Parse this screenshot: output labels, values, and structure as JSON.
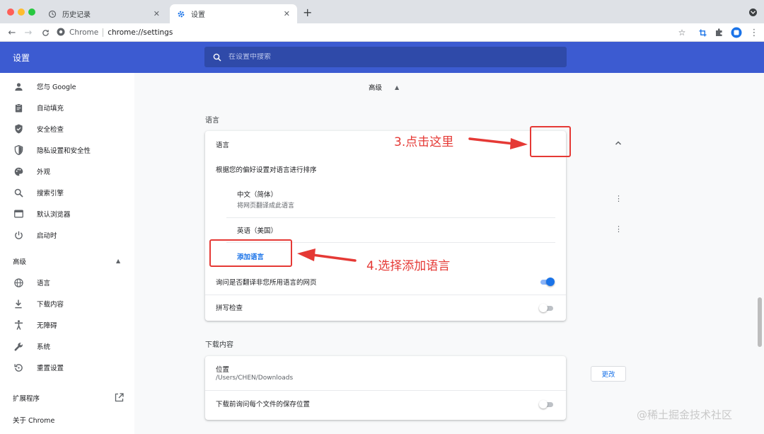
{
  "tabs": [
    {
      "title": "历史记录",
      "icon": "history-icon",
      "active": false
    },
    {
      "title": "设置",
      "icon": "gear-icon",
      "active": true
    }
  ],
  "toolbar": {
    "omnibox_chrome_label": "Chrome",
    "omnibox_url": "chrome://settings"
  },
  "header": {
    "title": "设置",
    "search_placeholder": "在设置中搜索"
  },
  "sidebar": {
    "items": [
      {
        "label": "您与 Google",
        "icon": "person-icon"
      },
      {
        "label": "自动填充",
        "icon": "clipboard-icon"
      },
      {
        "label": "安全检查",
        "icon": "shield-check-icon"
      },
      {
        "label": "隐私设置和安全性",
        "icon": "privacy-shield-icon"
      },
      {
        "label": "外观",
        "icon": "palette-icon"
      },
      {
        "label": "搜索引擎",
        "icon": "search-icon"
      },
      {
        "label": "默认浏览器",
        "icon": "browser-icon"
      },
      {
        "label": "启动时",
        "icon": "power-icon"
      }
    ],
    "advanced_label": "高级",
    "advanced_items": [
      {
        "label": "语言",
        "icon": "globe-icon"
      },
      {
        "label": "下载内容",
        "icon": "download-icon"
      },
      {
        "label": "无障碍",
        "icon": "accessibility-icon"
      },
      {
        "label": "系统",
        "icon": "wrench-icon"
      },
      {
        "label": "重置设置",
        "icon": "reset-icon"
      }
    ],
    "extensions_label": "扩展程序",
    "about_label": "关于 Chrome"
  },
  "main": {
    "advanced_toggle_label": "高级",
    "language_section": {
      "title": "语言",
      "header_label": "语言",
      "order_desc": "根据您的偏好设置对语言进行排序",
      "languages": [
        {
          "name": "中文（简体）",
          "subtitle": "将网页翻译成此语言"
        },
        {
          "name": "英语（美国）",
          "subtitle": ""
        }
      ],
      "add_language": "添加语言",
      "translate_offer": "询问是否翻译非您所用语言的网页",
      "translate_offer_enabled": true,
      "spell_check": "拼写检查",
      "spell_check_enabled": false
    },
    "downloads_section": {
      "title": "下载内容",
      "location_label": "位置",
      "location_path": "/Users/CHEN/Downloads",
      "change_button": "更改",
      "ask_where": "下载前询问每个文件的保存位置",
      "ask_where_enabled": false
    }
  },
  "annotations": {
    "step3": "3.点击这里",
    "step4": "4.选择添加语言",
    "color": "#e53935"
  },
  "watermark": "@稀土掘金技术社区",
  "colors": {
    "header_blue": "#3c5bd1",
    "link_blue": "#1a73e8",
    "annotation_red": "#e53935"
  }
}
